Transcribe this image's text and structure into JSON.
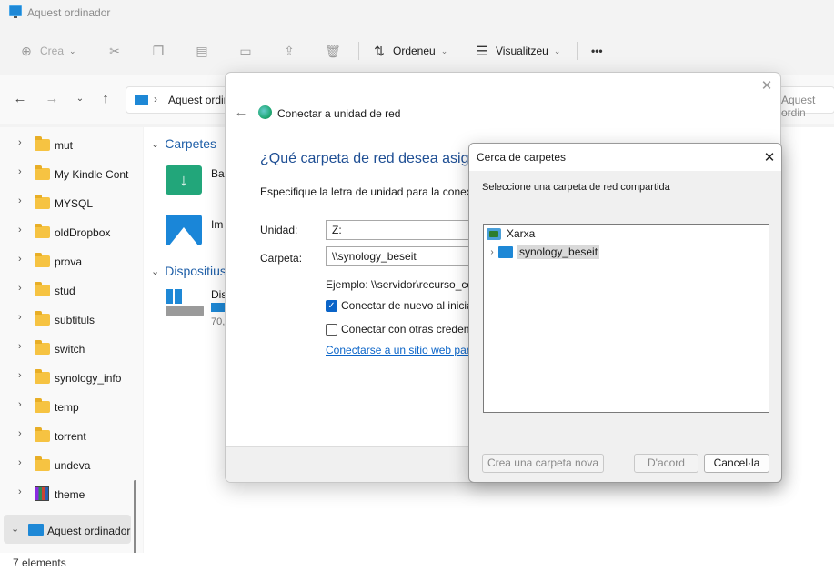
{
  "window": {
    "title": "Aquest ordinador"
  },
  "toolbar": {
    "new_label": "Crea",
    "sort_label": "Ordeneu",
    "view_label": "Visualitzeu",
    "more_label": "•••"
  },
  "address": {
    "separator": "›",
    "path": "Aquest ordinador",
    "search_placeholder": "Aquest ordin"
  },
  "sidebar": {
    "items": [
      {
        "label": "mut"
      },
      {
        "label": "My Kindle Content"
      },
      {
        "label": "MYSQL"
      },
      {
        "label": "oldDropbox"
      },
      {
        "label": "prova"
      },
      {
        "label": "stud"
      },
      {
        "label": "subtituls"
      },
      {
        "label": "switch"
      },
      {
        "label": "synology_info"
      },
      {
        "label": "temp"
      },
      {
        "label": "torrent"
      },
      {
        "label": "undeva"
      },
      {
        "label": "theme"
      }
    ],
    "selected": {
      "label": "Aquest ordinador"
    }
  },
  "content": {
    "folders_header": "Carpetes",
    "folders": [
      {
        "label": "Bai"
      },
      {
        "label": "Im"
      }
    ],
    "devices_header": "Dispositius",
    "drive": {
      "label": "Dis",
      "sub": "70,"
    }
  },
  "status": {
    "count": "7 elements"
  },
  "wizard": {
    "title": "Conectar a unidad de red",
    "heading": "¿Qué carpeta de red desea asignar?",
    "description": "Especifique la letra de unidad para la conexión",
    "unit_label": "Unidad:",
    "unit_value": "Z:",
    "folder_label": "Carpeta:",
    "folder_value": "\\\\synology_beseit",
    "example": "Ejemplo: \\\\servidor\\recurso_compartido",
    "reconnect_label": "Conectar de nuevo al iniciar sesión",
    "reconnect_checked": true,
    "other_creds_label": "Conectar con otras credenciales",
    "other_creds_checked": false,
    "link": "Conectarse a un sitio web para almacenar"
  },
  "browse": {
    "title": "Cerca de carpetes",
    "prompt": "Seleccione una carpeta de red compartida",
    "tree": [
      {
        "label": "Xarxa",
        "icon": "network-icon"
      },
      {
        "label": "synology_beseit",
        "icon": "server-icon",
        "selected": true
      }
    ],
    "new_folder_label": "Crea una carpeta nova",
    "ok_label": "D'acord",
    "cancel_label": "Cancel·la"
  }
}
